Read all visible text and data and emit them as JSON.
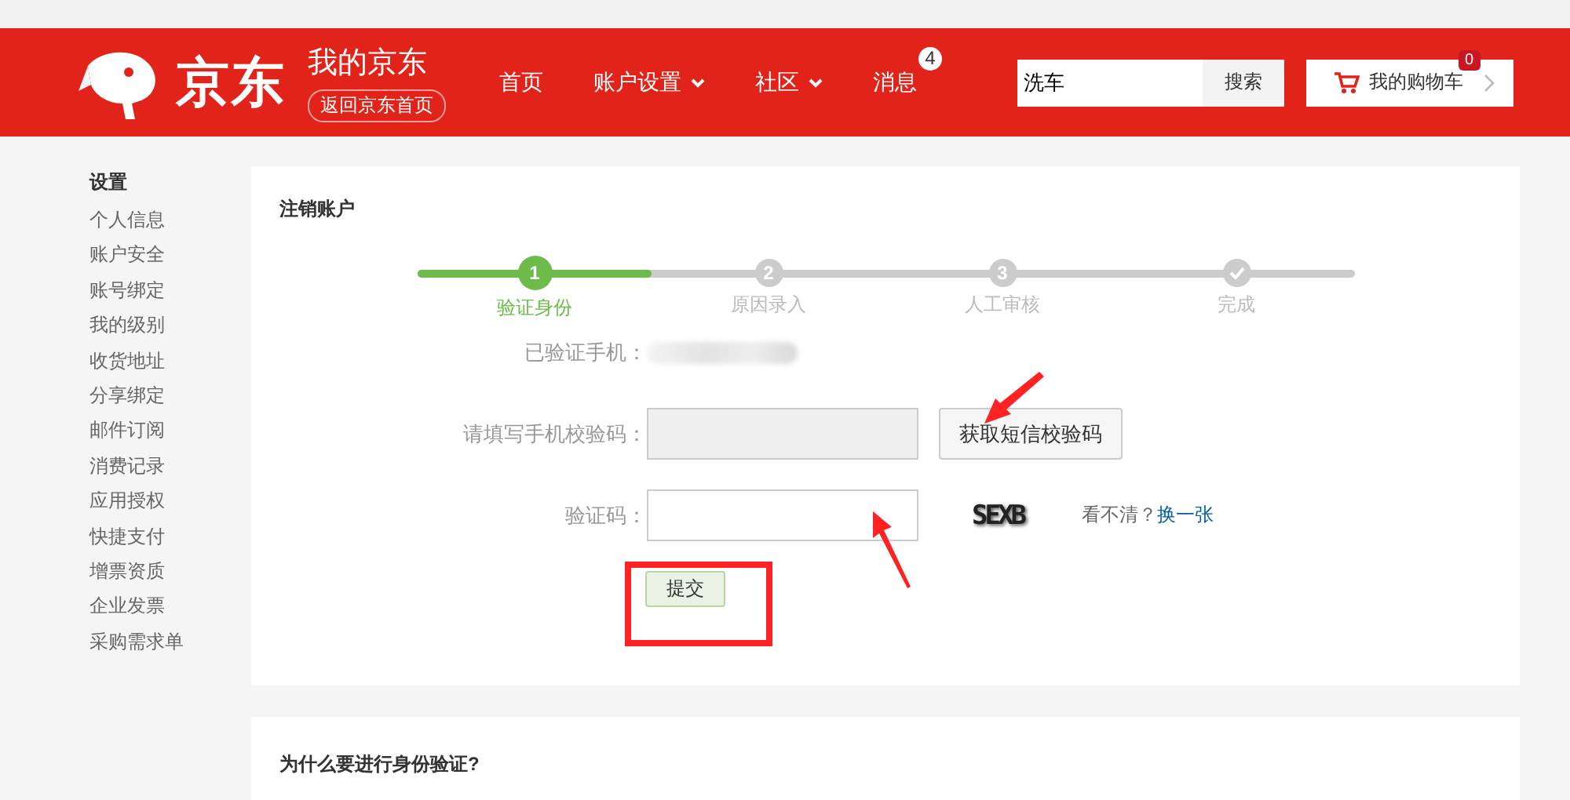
{
  "header": {
    "logo_text": "京东",
    "title": "我的京东",
    "home_link": "返回京东首页",
    "nav": [
      {
        "label": "首页",
        "dropdown": false
      },
      {
        "label": "账户设置",
        "dropdown": true
      },
      {
        "label": "社区",
        "dropdown": true
      },
      {
        "label": "消息",
        "dropdown": false,
        "badge": "4"
      }
    ],
    "search": {
      "value": "洗车",
      "button": "搜索"
    },
    "cart": {
      "label": "我的购物车",
      "badge": "0"
    }
  },
  "sidebar": {
    "heading": "设置",
    "items": [
      "个人信息",
      "账户安全",
      "账号绑定",
      "我的级别",
      "收货地址",
      "分享绑定",
      "邮件订阅",
      "消费记录",
      "应用授权",
      "快捷支付",
      "增票资质",
      "企业发票",
      "采购需求单"
    ]
  },
  "card": {
    "title": "注销账户",
    "steps": [
      {
        "kind": "number",
        "number": "1",
        "label": "验证身份",
        "selected": true
      },
      {
        "kind": "number",
        "number": "2",
        "label": "原因录入",
        "selected": false
      },
      {
        "kind": "number",
        "number": "3",
        "label": "人工审核",
        "selected": false
      },
      {
        "kind": "check",
        "label": "完成",
        "selected": false
      }
    ],
    "progress": {
      "level": 0.25
    },
    "phone_label": "已验证手机：",
    "sms_label": "请填写手机校验码：",
    "sms_field": {
      "disabled": true
    },
    "sms_button": "获取短信校验码",
    "captcha_label": "验证码：",
    "captcha_text": "SEXB",
    "unclear": "看不清？",
    "refresh_link": "换一张",
    "submit": "提交"
  },
  "faq": {
    "title": "为什么要进行身份验证?"
  }
}
